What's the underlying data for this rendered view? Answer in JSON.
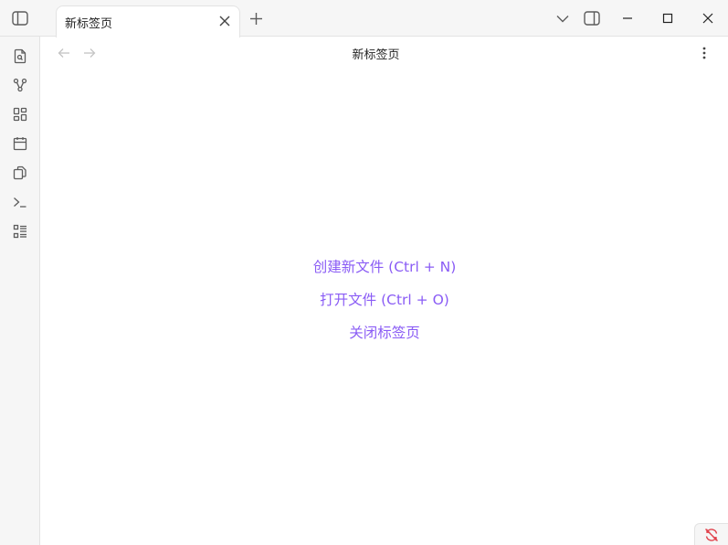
{
  "tab": {
    "title": "新标签页"
  },
  "view": {
    "title": "新标签页"
  },
  "actions": [
    {
      "label": "创建新文件 (Ctrl + N)"
    },
    {
      "label": "打开文件 (Ctrl + O)"
    },
    {
      "label": "关闭标签页"
    }
  ],
  "colors": {
    "accent": "#8a5cf5",
    "ribbon_bg": "#f6f6f6",
    "icon": "#5c5c5c",
    "sync_error": "#e0414b"
  },
  "ribbon_icons": [
    "file-search-icon",
    "graph-icon",
    "canvas-icon",
    "calendar-icon",
    "copy-icon",
    "terminal-icon",
    "list-icon"
  ]
}
